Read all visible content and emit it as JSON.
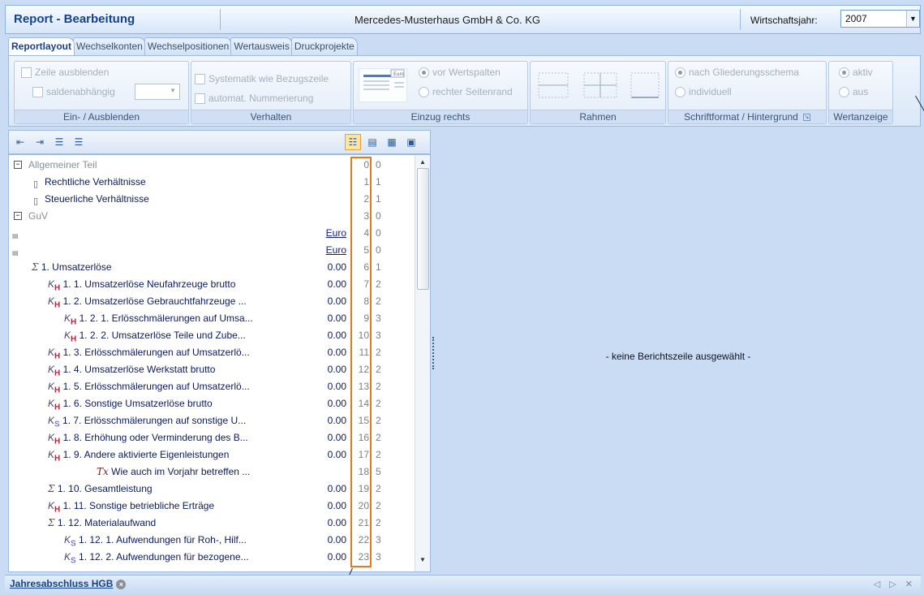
{
  "window": {
    "title": "Report - Bearbeitung",
    "company": "Mercedes-Musterhaus GmbH & Co. KG",
    "year_label": "Wirtschaftsjahr:",
    "year_value": "2007"
  },
  "tabs": [
    {
      "label": "Reportlayout",
      "active": true
    },
    {
      "label": "Wechselkonten",
      "active": false
    },
    {
      "label": "Wechselpositionen",
      "active": false
    },
    {
      "label": "Wertausweis",
      "active": false
    },
    {
      "label": "Druckprojekte",
      "active": false
    }
  ],
  "ribbon": {
    "ein_aus": {
      "label": "Ein- / Ausblenden",
      "zeile_ausblenden": "Zeile ausblenden",
      "saldenabhaengig": "saldenabhängig"
    },
    "verhalten": {
      "label": "Verhalten",
      "systematik": "Systematik wie Bezugszeile",
      "nummerierung": "automat. Nummerierung"
    },
    "einzug": {
      "label": "Einzug rechts",
      "icon_caption": "Euro",
      "vor_wertspalten": "vor Wertspalten",
      "rechter_seitenrand": "rechter Seitenrand"
    },
    "rahmen": {
      "label": "Rahmen"
    },
    "schriftformat": {
      "label": "Schriftformat / Hintergrund",
      "nach_gliederung": "nach Gliederungsschema",
      "individuell": "individuell"
    },
    "wertanzeige": {
      "label": "Wertanzeige",
      "aktiv": "aktiv",
      "aus": "aus"
    }
  },
  "tree": {
    "rows": [
      {
        "type": "group",
        "text": "Allgemeiner Teil",
        "value": "",
        "num": "0",
        "level": "0",
        "indent": 0
      },
      {
        "type": "doc",
        "text": "Rechtliche Verhältnisse",
        "value": "",
        "num": "1",
        "level": "1",
        "indent": 1
      },
      {
        "type": "doc",
        "text": "Steuerliche Verhältnisse",
        "value": "",
        "num": "2",
        "level": "1",
        "indent": 1
      },
      {
        "type": "group",
        "text": "GuV",
        "value": "",
        "num": "3",
        "level": "0",
        "indent": 0
      },
      {
        "type": "euro",
        "text": "",
        "value": "Euro",
        "num": "4",
        "level": "0",
        "indent": 0
      },
      {
        "type": "euro",
        "text": "",
        "value": "Euro",
        "num": "5",
        "level": "0",
        "indent": 0
      },
      {
        "type": "sum",
        "text": "1.  Umsatzerlöse",
        "value": "0.00",
        "num": "6",
        "level": "1",
        "indent": 1
      },
      {
        "type": "kh",
        "text": "1. 1.  Umsatzerlöse Neufahrzeuge brutto",
        "value": "0.00",
        "num": "7",
        "level": "2",
        "indent": 2
      },
      {
        "type": "kh",
        "text": "1. 2.  Umsatzerlöse Gebrauchtfahrzeuge ...",
        "value": "0.00",
        "num": "8",
        "level": "2",
        "indent": 2
      },
      {
        "type": "kh",
        "text": "1. 2. 1.  Erlösschmälerungen auf Umsa...",
        "value": "0.00",
        "num": "9",
        "level": "3",
        "indent": 3
      },
      {
        "type": "kh",
        "text": "1. 2. 2.  Umsatzerlöse Teile und Zube...",
        "value": "0.00",
        "num": "10",
        "level": "3",
        "indent": 3
      },
      {
        "type": "kh",
        "text": "1. 3.  Erlösschmälerungen auf Umsatzerlö...",
        "value": "0.00",
        "num": "11",
        "level": "2",
        "indent": 2
      },
      {
        "type": "kh",
        "text": "1. 4.  Umsatzerlöse Werkstatt brutto",
        "value": "0.00",
        "num": "12",
        "level": "2",
        "indent": 2
      },
      {
        "type": "kh",
        "text": "1. 5.  Erlösschmälerungen auf Umsatzerlö...",
        "value": "0.00",
        "num": "13",
        "level": "2",
        "indent": 2
      },
      {
        "type": "kh",
        "text": "1. 6.  Sonstige Umsatzerlöse brutto",
        "value": "0.00",
        "num": "14",
        "level": "2",
        "indent": 2
      },
      {
        "type": "ks",
        "text": "1. 7.  Erlösschmälerungen auf sonstige U...",
        "value": "0.00",
        "num": "15",
        "level": "2",
        "indent": 2
      },
      {
        "type": "kh",
        "text": "1. 8.  Erhöhung oder Verminderung des B...",
        "value": "0.00",
        "num": "16",
        "level": "2",
        "indent": 2
      },
      {
        "type": "kh",
        "text": "1. 9.  Andere aktivierte Eigenleistungen",
        "value": "0.00",
        "num": "17",
        "level": "2",
        "indent": 2
      },
      {
        "type": "tx",
        "text": "Wie auch im Vorjahr betreffen ...",
        "value": "",
        "num": "18",
        "level": "5",
        "indent": 5
      },
      {
        "type": "sum",
        "text": "1. 10.  Gesamtleistung",
        "value": "0.00",
        "num": "19",
        "level": "2",
        "indent": 2
      },
      {
        "type": "kh",
        "text": "1. 11.  Sonstige betriebliche Erträge",
        "value": "0.00",
        "num": "20",
        "level": "2",
        "indent": 2
      },
      {
        "type": "sum",
        "text": "1. 12.  Materialaufwand",
        "value": "0.00",
        "num": "21",
        "level": "2",
        "indent": 2
      },
      {
        "type": "ks",
        "text": "1. 12. 1.  Aufwendungen für Roh-, Hilf...",
        "value": "0.00",
        "num": "22",
        "level": "3",
        "indent": 3
      },
      {
        "type": "ks",
        "text": "1. 12. 2.  Aufwendungen für bezogene...",
        "value": "0.00",
        "num": "23",
        "level": "3",
        "indent": 3
      }
    ]
  },
  "detail": {
    "message": "- keine Berichtszeile ausgewählt -"
  },
  "status": {
    "tab_label": "Jahresabschluss HGB",
    "close_glyph": "×",
    "nav": "◁ ▷ ✕"
  }
}
